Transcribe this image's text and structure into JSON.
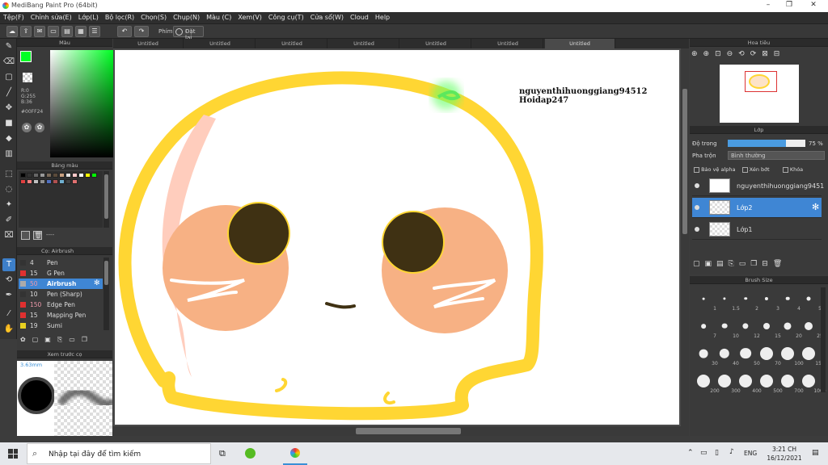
{
  "window": {
    "title": "MediBang Paint Pro (64bit)"
  },
  "menu": [
    "Tệp(F)",
    "Chỉnh sửa(E)",
    "Lớp(L)",
    "Bộ lọc(R)",
    "Chọn(S)",
    "Chụp(N)",
    "Màu (C)",
    "Xem(V)",
    "Công cụ(T)",
    "Cửa sổ(W)",
    "Cloud",
    "Help"
  ],
  "toolbar": {
    "phim_label": "Phím",
    "reset_label": "Đặt lại"
  },
  "color_panel": {
    "title": "Màu",
    "r": "R:0",
    "g": "G:255",
    "b": "B:36",
    "hex": "#00FF24",
    "fg": "#00ff24"
  },
  "palette_panel": {
    "title": "Bảng màu",
    "footer": "----"
  },
  "brush_panel": {
    "title": "Cọ: Airbrush",
    "items": [
      {
        "size": "4",
        "name": "Pen",
        "color": "#333333"
      },
      {
        "size": "15",
        "name": "G Pen",
        "color": "#e03030"
      },
      {
        "size": "50",
        "name": "Airbrush",
        "color": "#aaaaaa"
      },
      {
        "size": "10",
        "name": "Pen (Sharp)",
        "color": "#333333"
      },
      {
        "size": "150",
        "name": "Edge Pen",
        "color": "#e03030"
      },
      {
        "size": "15",
        "name": "Mapping Pen",
        "color": "#e03030"
      },
      {
        "size": "19",
        "name": "Sumi",
        "color": "#e8d020"
      }
    ]
  },
  "preview_panel": {
    "title": "Xem trước cọ",
    "size": "3.63mm"
  },
  "tabs": [
    "Untitled",
    "Untitled",
    "Untitled",
    "Untitled",
    "Untitled",
    "Untitled",
    "Untitled"
  ],
  "canvas": {
    "watermark1": "nguyenthihuonggiang94512",
    "watermark2": "Hoidap247"
  },
  "navigator": {
    "title": "Hoa tiêu"
  },
  "layer_panel": {
    "title": "Lớp",
    "opacity_label": "Độ trong",
    "opacity_value": "75 %",
    "opacity": 0.75,
    "blend_label": "Pha trộn",
    "blend_value": "Bình thường",
    "protect_alpha": "Bảo vệ alpha",
    "clip": "Xén bớt",
    "lock": "Khóa",
    "layers": [
      {
        "name": "nguyenthihuonggiang9451"
      },
      {
        "name": "Lớp2"
      },
      {
        "name": "Lớp1"
      }
    ]
  },
  "brush_size_panel": {
    "title": "Brush Size",
    "sizes": [
      "1",
      "1.5",
      "2",
      "3",
      "4",
      "5",
      "7",
      "10",
      "12",
      "15",
      "20",
      "25",
      "30",
      "40",
      "50",
      "70",
      "100",
      "150",
      "200",
      "300",
      "400",
      "500",
      "700",
      "1000"
    ]
  },
  "taskbar": {
    "search_placeholder": "Nhập tại đây để tìm kiếm",
    "lang": "ENG",
    "time": "3:21 CH",
    "date": "16/12/2021"
  }
}
